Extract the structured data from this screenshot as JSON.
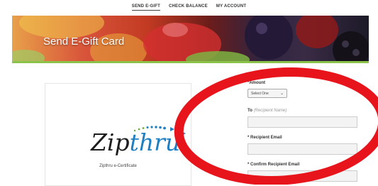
{
  "nav": {
    "items": [
      {
        "label": "SEND E-GIFT",
        "active": true
      },
      {
        "label": "CHECK BALANCE",
        "active": false
      },
      {
        "label": "MY ACCOUNT",
        "active": false
      }
    ]
  },
  "banner": {
    "title": "Send E-Gift Card"
  },
  "card": {
    "logo_part1": "Zip",
    "logo_part2": "thru",
    "caption": "Zipthru e-Certificate"
  },
  "form": {
    "amount_label": "*Amount",
    "amount_value": "Select One",
    "to_label": "To",
    "to_hint": "(Recipient Name)",
    "recipient_email_label": "* Recipient Email",
    "confirm_email_label": "* Confirm Recipient Email"
  },
  "colors": {
    "accent_green": "#8bc34a",
    "logo_blue": "#1f7fc0",
    "annotation_red": "#e8141c"
  }
}
